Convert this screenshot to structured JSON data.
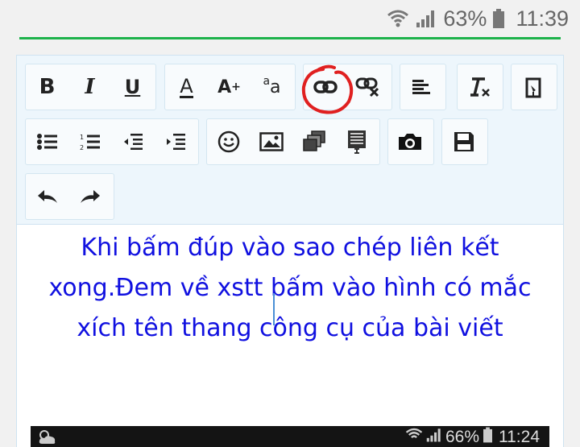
{
  "status_bar": {
    "battery": "63%",
    "time": "11:39"
  },
  "toolbar": {
    "bold": "B",
    "italic": "I",
    "underline": "U",
    "font_color": "A",
    "font_size": "A",
    "font_size_mark": "+",
    "case_top": "a",
    "case_bottom": "a"
  },
  "content": {
    "lines": [
      "Khi bấm đúp vào sao chép liên kết",
      "xong.Đem về xstt bấm vào hình có mắc",
      "xích tên thang công cụ của bài viết"
    ]
  },
  "inner_screenshot": {
    "battery": "66%",
    "time": "11:24"
  },
  "colors": {
    "text": "#1010e0",
    "annotation": "#e02020",
    "accent_line": "#1db24b"
  }
}
